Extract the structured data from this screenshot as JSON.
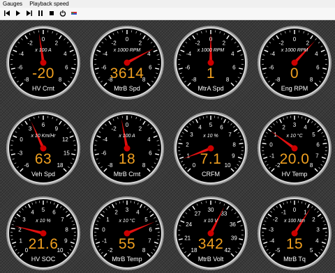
{
  "menu": {
    "gauges": "Gauges",
    "playback": "Playback speed"
  },
  "toolbar": [
    "skip-back-icon",
    "play-icon",
    "skip-forward-icon",
    "pause-icon",
    "stop-icon",
    "power-icon",
    "flag-icon"
  ],
  "colors": {
    "value": "#f0a020",
    "needle": "#e01010",
    "dial": "#000000"
  },
  "gauges": [
    {
      "label": "HV Crnt",
      "scale": "x 100 A",
      "value": "-20",
      "ticks": [
        "-8",
        "-6",
        "-4",
        "-2",
        "0",
        "2",
        "4",
        "6",
        "8"
      ],
      "needle": 0.47
    },
    {
      "label": "MtrB Spd",
      "scale": "x 1000 RPM",
      "value": "3614",
      "ticks": [
        "-8",
        "-6",
        "-4",
        "-2",
        "0",
        "2",
        "4",
        "6",
        "8"
      ],
      "needle": 0.73
    },
    {
      "label": "MtrA Spd",
      "scale": "x 1000 RPM",
      "value": "1",
      "ticks": [
        "-8",
        "-6",
        "-4",
        "-2",
        "0",
        "2",
        "4",
        "6",
        "8"
      ],
      "needle": 0.5
    },
    {
      "label": "Eng RPM",
      "scale": "x 1000 RPM",
      "value": "0",
      "ticks": [
        "-8",
        "-6",
        "-4",
        "-2",
        "0",
        "2",
        "4",
        "6",
        "8"
      ],
      "needle": 0.66
    },
    {
      "label": "Veh Spd",
      "scale": "x 10 Km/Hr",
      "value": "63",
      "ticks": [
        "-6",
        "-3",
        "0",
        "3",
        "6",
        "9",
        "12",
        "15",
        "18"
      ],
      "needle": 0.41
    },
    {
      "label": "MtrB Crnt",
      "scale": "x 100 A",
      "value": "18",
      "ticks": [
        "-8",
        "-6",
        "-4",
        "-2",
        "0",
        "2",
        "4",
        "6",
        "8"
      ],
      "needle": 0.46
    },
    {
      "label": "CRFM",
      "scale": "x 10 %",
      "value": "7.1",
      "ticks": [
        "0",
        "1",
        "2",
        "3",
        "4",
        "5",
        "6",
        "7",
        "8",
        "9",
        "10"
      ],
      "needle": 0.09
    },
    {
      "label": "HV Temp",
      "scale": "x 10 °C",
      "value": "20.0",
      "ticks": [
        "-2",
        "-1",
        "0",
        "1",
        "2",
        "3",
        "4",
        "5",
        "6",
        "7",
        "8"
      ],
      "needle": 0.3
    },
    {
      "label": "HV SOC",
      "scale": "x 10 %",
      "value": "21.6",
      "ticks": [
        "0",
        "1",
        "2",
        "3",
        "4",
        "5",
        "6",
        "7",
        "8",
        "9",
        "10"
      ],
      "needle": 0.22
    },
    {
      "label": "MtrB Temp",
      "scale": "x 10 °C",
      "value": "55",
      "ticks": [
        "-2",
        "-1",
        "0",
        "1",
        "2",
        "3",
        "4",
        "5",
        "6",
        "7",
        "8"
      ],
      "needle": 0.75
    },
    {
      "label": "MtrB Volt",
      "scale": "x 10 V",
      "value": "342",
      "ticks": [
        "18",
        "21",
        "24",
        "27",
        "30",
        "33",
        "36",
        "39",
        "42"
      ],
      "needle": 0.6
    },
    {
      "label": "MtrB Tq",
      "scale": "x 100 Nm",
      "value": "15",
      "ticks": [
        "-5",
        "-4",
        "-3",
        "-2",
        "-1",
        "0",
        "1",
        "2",
        "3",
        "4",
        "5"
      ],
      "needle": 0.62
    }
  ]
}
